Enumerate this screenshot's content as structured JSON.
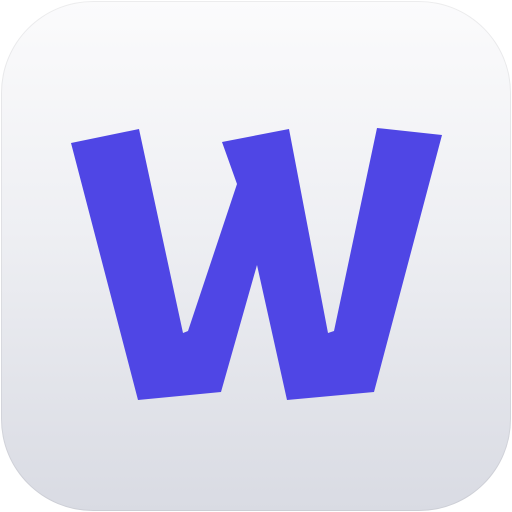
{
  "app_icon": {
    "letter": "W",
    "icon_name": "w-letter-logo-icon",
    "colors": {
      "glyph": "#4f46e5",
      "tile_top": "#fbfbfc",
      "tile_bottom": "#d9dbe3"
    }
  }
}
